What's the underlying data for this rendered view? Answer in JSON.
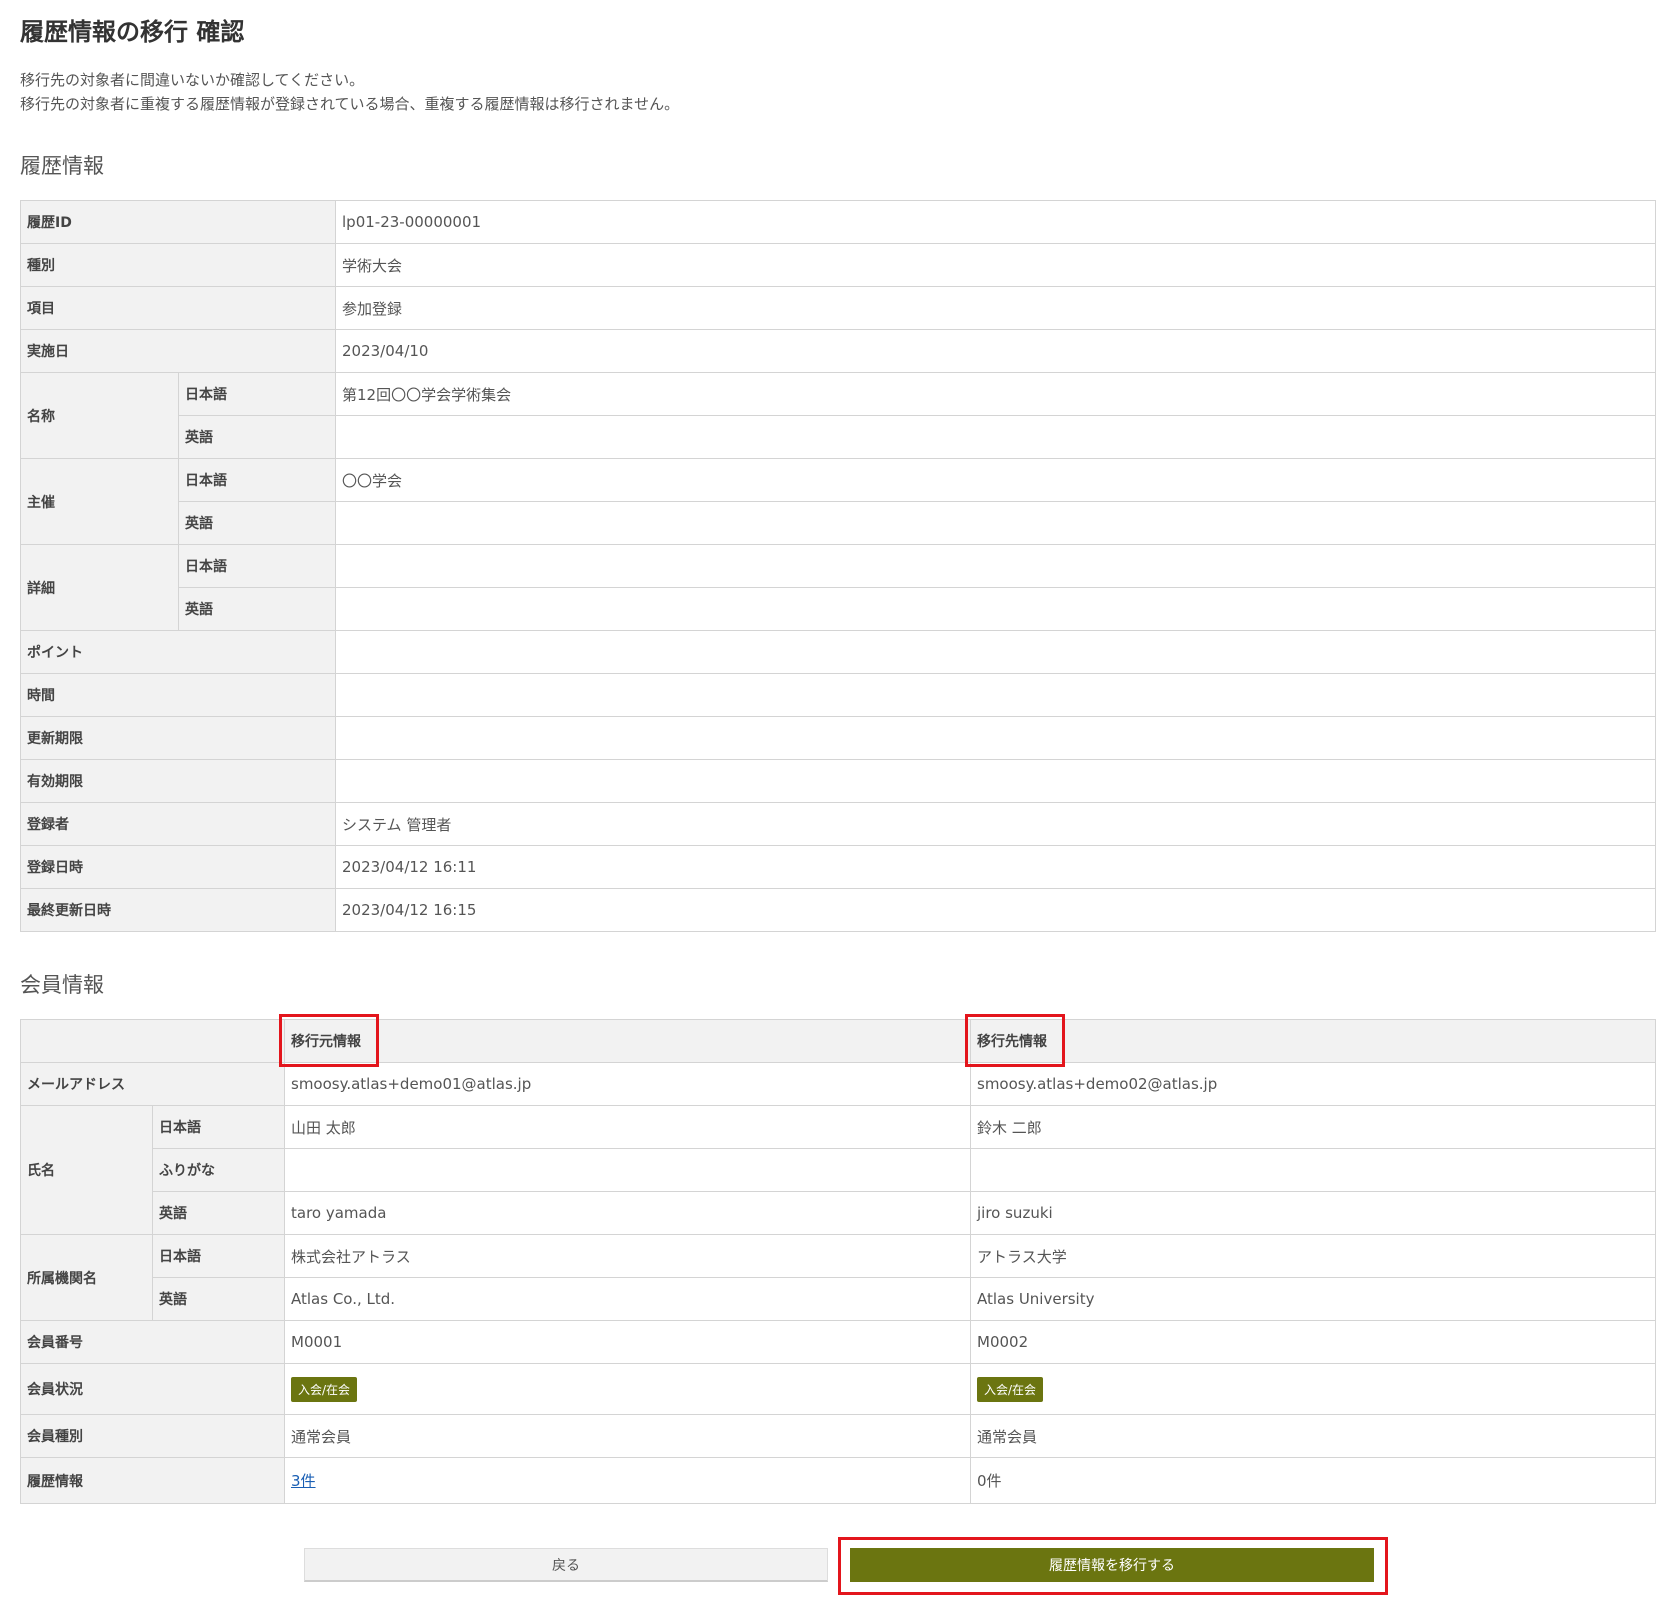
{
  "page": {
    "title": "履歴情報の移行 確認",
    "intro": [
      "移行先の対象者に間違いないか確認してください。",
      "移行先の対象者に重複する履歴情報が登録されている場合、重複する履歴情報は移行されません。"
    ]
  },
  "history": {
    "section_title": "履歴情報",
    "rows": {
      "id": {
        "label": "履歴ID",
        "value": "lp01-23-00000001"
      },
      "kind": {
        "label": "種別",
        "value": "学術大会"
      },
      "item": {
        "label": "項目",
        "value": "参加登録"
      },
      "date": {
        "label": "実施日",
        "value": "2023/04/10"
      },
      "name": {
        "label": "名称",
        "ja_label": "日本語",
        "ja_value": "第12回〇〇学会学術集会",
        "en_label": "英語",
        "en_value": ""
      },
      "host": {
        "label": "主催",
        "ja_label": "日本語",
        "ja_value": "〇〇学会",
        "en_label": "英語",
        "en_value": ""
      },
      "detail": {
        "label": "詳細",
        "ja_label": "日本語",
        "ja_value": "",
        "en_label": "英語",
        "en_value": ""
      },
      "point": {
        "label": "ポイント",
        "value": ""
      },
      "time": {
        "label": "時間",
        "value": ""
      },
      "renewal": {
        "label": "更新期限",
        "value": ""
      },
      "expiry": {
        "label": "有効期限",
        "value": ""
      },
      "registrant": {
        "label": "登録者",
        "value": "システム 管理者"
      },
      "registered_at": {
        "label": "登録日時",
        "value": "2023/04/12 16:11"
      },
      "updated_at": {
        "label": "最終更新日時",
        "value": "2023/04/12 16:15"
      }
    }
  },
  "member": {
    "section_title": "会員情報",
    "source_header": "移行元情報",
    "target_header": "移行先情報",
    "rows": {
      "email": {
        "label": "メールアドレス",
        "source": "smoosy.atlas+demo01@atlas.jp",
        "target": "smoosy.atlas+demo02@atlas.jp"
      },
      "name": {
        "label": "氏名",
        "ja_label": "日本語",
        "ja_source": "山田 太郎",
        "ja_target": "鈴木 二郎",
        "kana_label": "ふりがな",
        "kana_source": "",
        "kana_target": "",
        "en_label": "英語",
        "en_source": "taro yamada",
        "en_target": "jiro suzuki"
      },
      "org": {
        "label": "所属機関名",
        "ja_label": "日本語",
        "ja_source": "株式会社アトラス",
        "ja_target": "アトラス大学",
        "en_label": "英語",
        "en_source": "Atlas Co., Ltd.",
        "en_target": "Atlas University"
      },
      "number": {
        "label": "会員番号",
        "source": "M0001",
        "target": "M0002"
      },
      "status": {
        "label": "会員状況",
        "source": "入会/在会",
        "target": "入会/在会"
      },
      "type": {
        "label": "会員種別",
        "source": "通常会員",
        "target": "通常会員"
      },
      "history": {
        "label": "履歴情報",
        "source": "3件",
        "target": "0件"
      }
    }
  },
  "buttons": {
    "back": "戻る",
    "migrate": "履歴情報を移行する"
  },
  "colors": {
    "accent": "#6b7510",
    "highlight": "#e3151c",
    "link": "#1a5fb4"
  }
}
